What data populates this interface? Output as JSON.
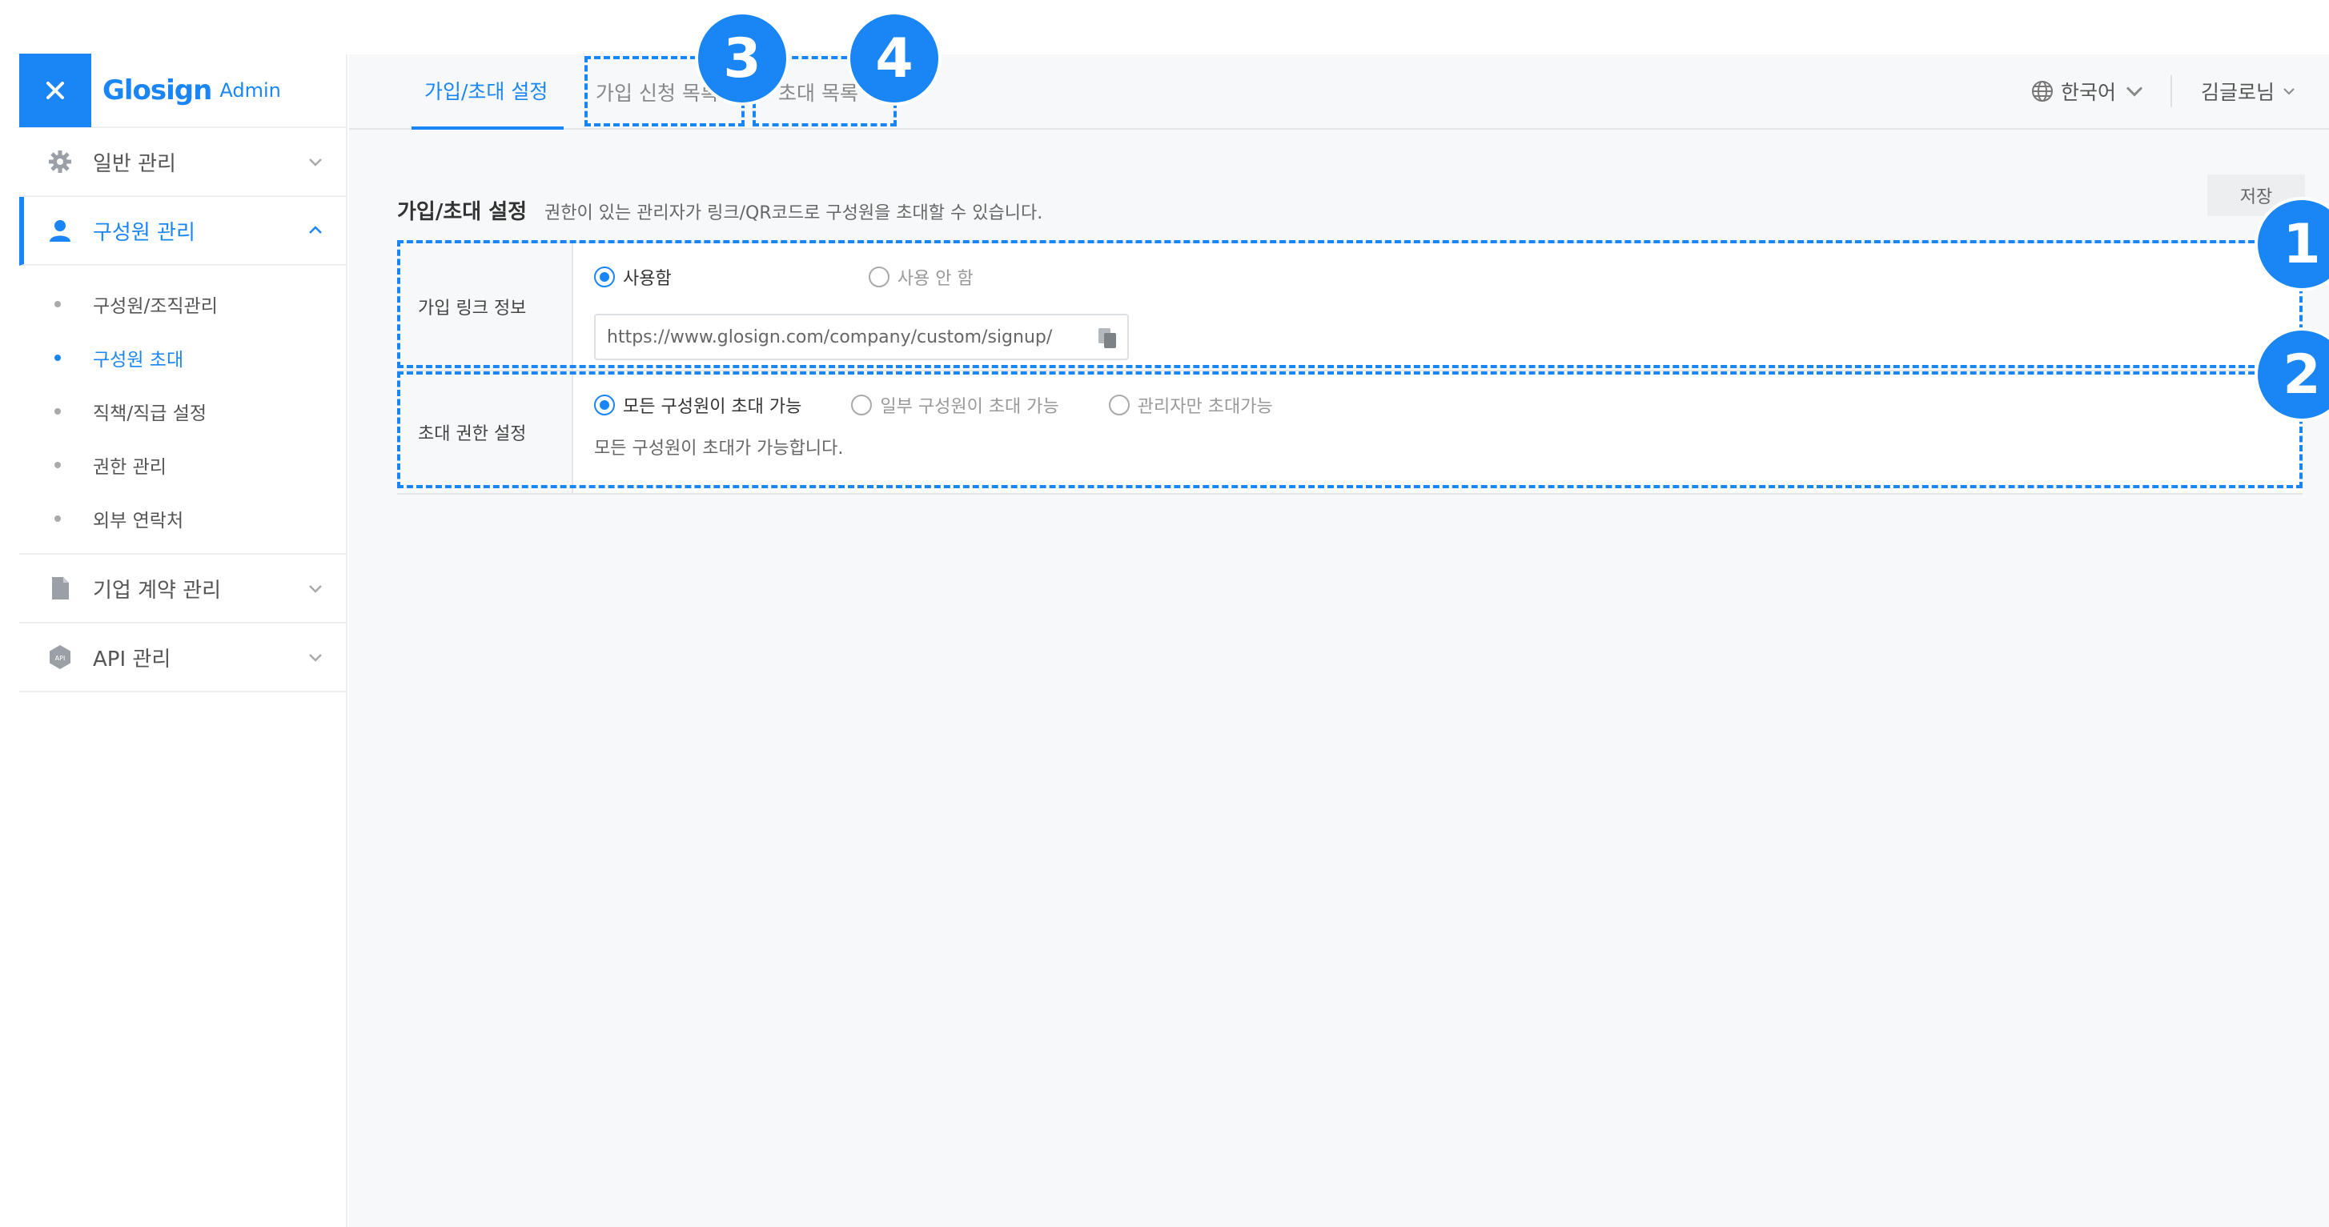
{
  "brand": {
    "name": "Glosign",
    "sub": "Admin"
  },
  "sidebar": {
    "items": [
      {
        "label": "일반 관리",
        "icon": "gear-icon"
      },
      {
        "label": "구성원 관리",
        "icon": "user-icon"
      },
      {
        "label": "기업 계약 관리",
        "icon": "document-icon"
      },
      {
        "label": "API 관리",
        "icon": "api-icon"
      }
    ],
    "sub_items": [
      {
        "label": "구성원/조직관리"
      },
      {
        "label": "구성원 초대"
      },
      {
        "label": "직책/직급 설정"
      },
      {
        "label": "권한 관리"
      },
      {
        "label": "외부 연락처"
      }
    ]
  },
  "topbar": {
    "tabs": [
      {
        "label": "가입/초대 설정"
      },
      {
        "label": "가입 신청 목록"
      },
      {
        "label": "초대 목록"
      }
    ],
    "language": "한국어",
    "user": "김글로님"
  },
  "section": {
    "title": "가입/초대 설정",
    "description": "권한이 있는 관리자가 링크/QR코드로 구성원을 초대할 수 있습니다.",
    "save_label": "저장"
  },
  "form": {
    "row1": {
      "label": "가입 링크 정보",
      "options": [
        "사용함",
        "사용 안 함"
      ],
      "selected": "사용함",
      "url": "https://www.glosign.com/company/custom/signup/"
    },
    "row2": {
      "label": "초대 권한 설정",
      "options": [
        "모든 구성원이 초대 가능",
        "일부 구성원이 초대 가능",
        "관리자만 초대가능"
      ],
      "selected": "모든 구성원이 초대 가능",
      "helper": "모든 구성원이 초대가 가능합니다."
    }
  },
  "annotations": [
    "1",
    "2",
    "3",
    "4"
  ],
  "colors": {
    "accent": "#1a86f5",
    "border": "#e3e5e8",
    "background": "#f7f8f9"
  }
}
